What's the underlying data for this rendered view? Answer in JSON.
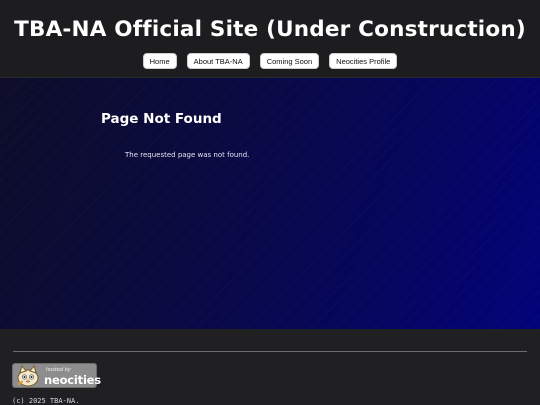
{
  "header": {
    "title": "TBA-NA Official Site (Under Construction)",
    "nav": [
      {
        "label": "Home"
      },
      {
        "label": "About TBA-NA"
      },
      {
        "label": "Coming Soon"
      },
      {
        "label": "Neocities Profile"
      }
    ]
  },
  "main": {
    "heading": "Page Not Found",
    "message": "The requested page was not found."
  },
  "footer": {
    "badge": {
      "line1": "hosted by",
      "line2": "neocities",
      "icon": "neocities-cat-icon"
    },
    "copyright": "(c) 2025 TBA-NA."
  },
  "colors": {
    "header_bg": "#1d1d20",
    "main_gradient_start": "#0d0d2a",
    "main_gradient_end": "#03037a",
    "footer_bg": "#202023",
    "button_bg": "#ffffff"
  }
}
